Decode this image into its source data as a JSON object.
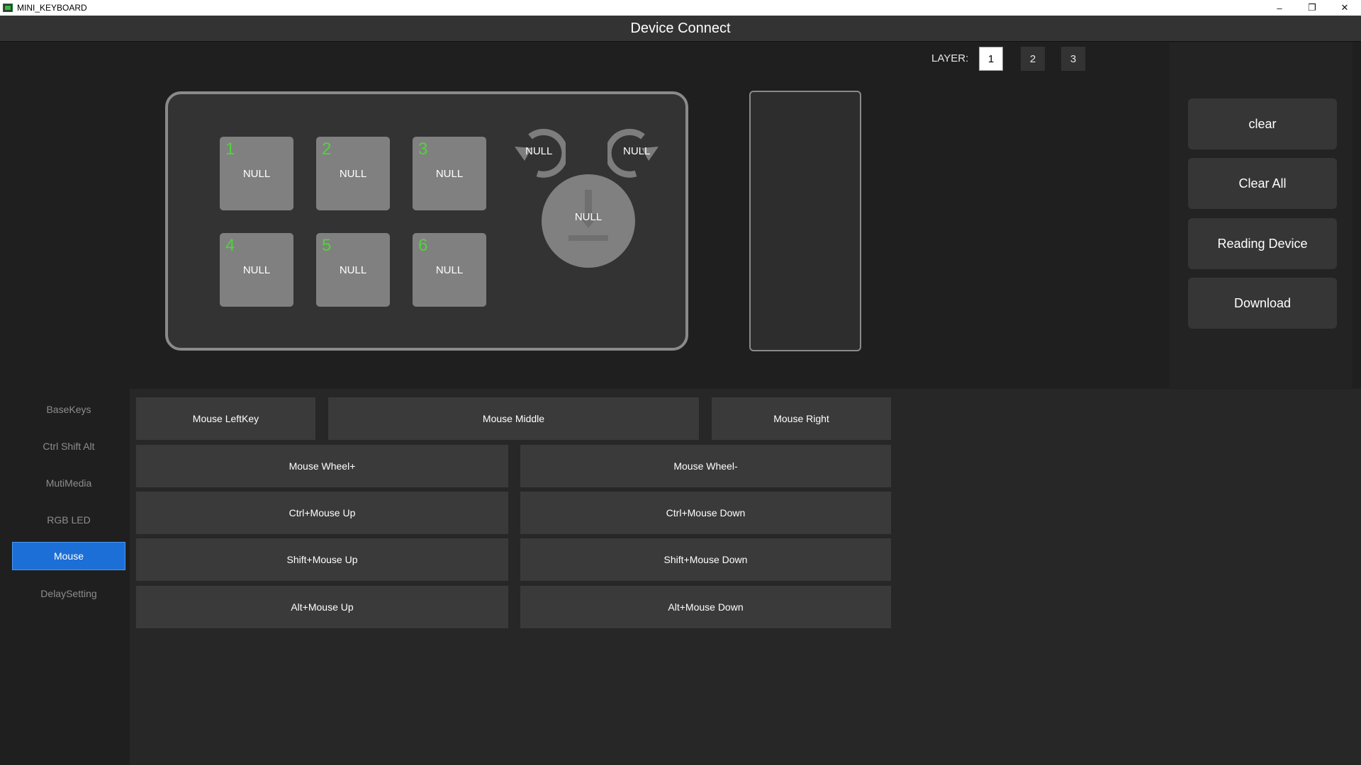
{
  "window": {
    "title": "MINI_KEYBOARD",
    "controls": {
      "minimize": "–",
      "restore": "❐",
      "close": "✕"
    }
  },
  "header": {
    "title": "Device Connect"
  },
  "layer": {
    "label": "LAYER:",
    "options": [
      "1",
      "2",
      "3"
    ],
    "selected": "1"
  },
  "keyboard": {
    "keys": [
      {
        "num": "1",
        "label": "NULL"
      },
      {
        "num": "2",
        "label": "NULL"
      },
      {
        "num": "3",
        "label": "NULL"
      },
      {
        "num": "4",
        "label": "NULL"
      },
      {
        "num": "5",
        "label": "NULL"
      },
      {
        "num": "6",
        "label": "NULL"
      }
    ],
    "knob": {
      "ccw_label": "NULL",
      "cw_label": "NULL",
      "press_label": "NULL"
    },
    "key_number_color": "#4fd43a"
  },
  "actions": {
    "clear": "clear",
    "clear_all": "Clear All",
    "reading_device": "Reading Device",
    "download": "Download"
  },
  "sidebar": {
    "items": [
      {
        "label": "BaseKeys"
      },
      {
        "label": "Ctrl Shift Alt"
      },
      {
        "label": "MutiMedia"
      },
      {
        "label": "RGB LED"
      },
      {
        "label": "Mouse"
      },
      {
        "label": "DelaySetting"
      }
    ],
    "active": "Mouse",
    "accent_color": "#1c6fd6"
  },
  "mouse_functions": {
    "left": "Mouse LeftKey",
    "middle": "Mouse Middle",
    "right": "Mouse Right",
    "wheel_up": "Mouse Wheel+",
    "wheel_down": "Mouse Wheel-",
    "ctrl_up": "Ctrl+Mouse Up",
    "ctrl_down": "Ctrl+Mouse Down",
    "shift_up": "Shift+Mouse Up",
    "shift_down": "Shift+Mouse Down",
    "alt_up": "Alt+Mouse Up",
    "alt_down": "Alt+Mouse Down"
  }
}
